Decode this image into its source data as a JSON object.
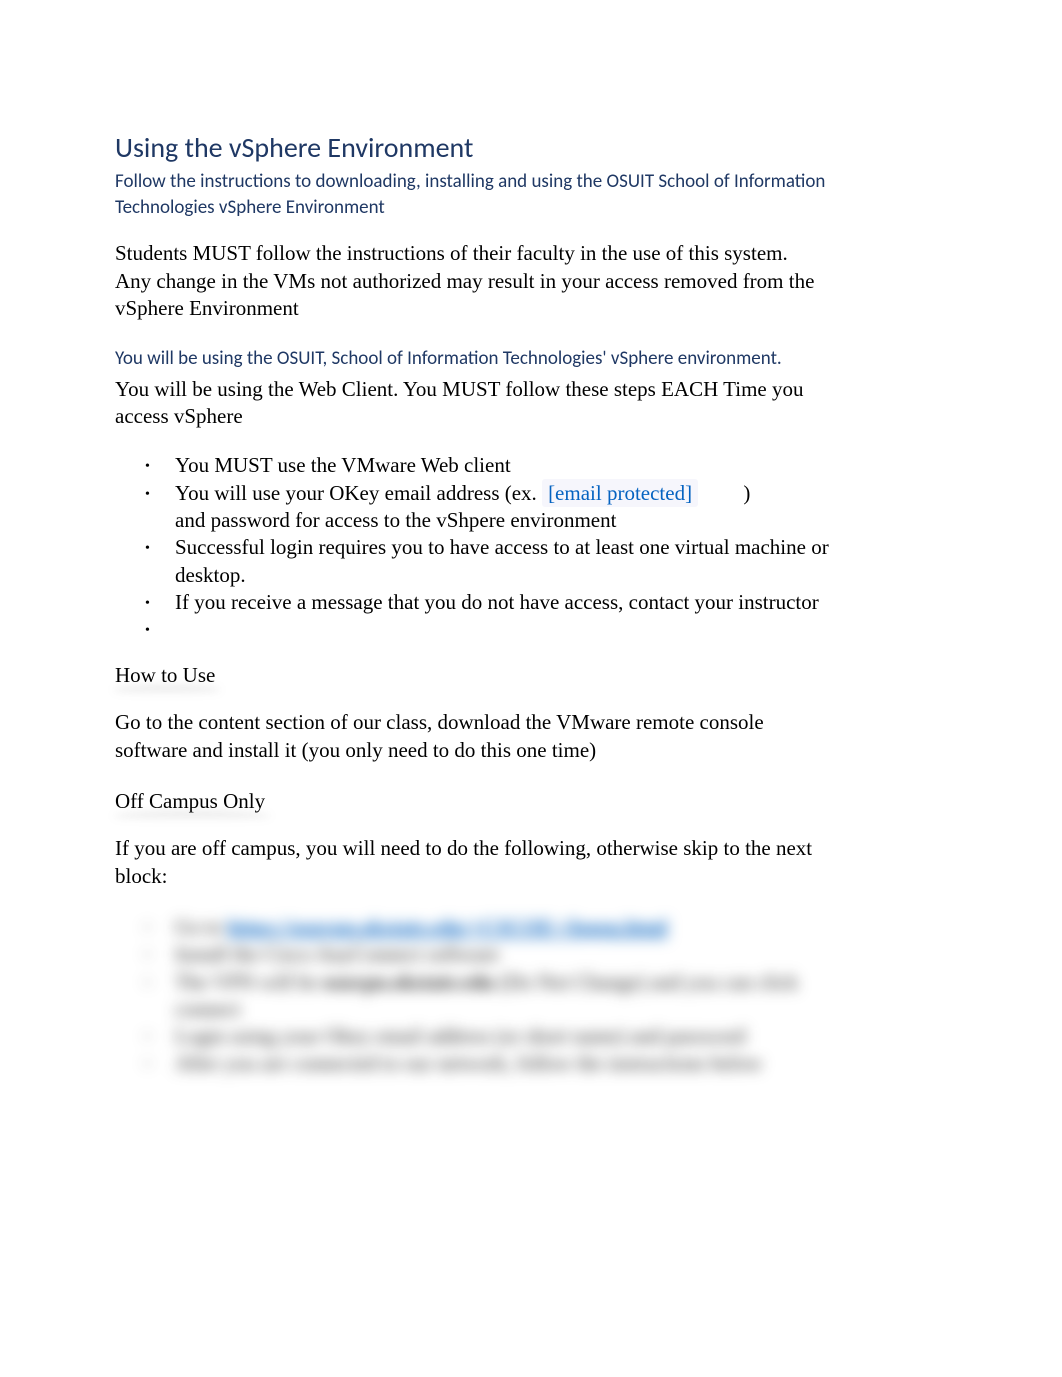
{
  "title": "Using the vSphere Environment",
  "subtitle": "Follow the instructions to downloading, installing and using the OSUIT School of Information Technologies vSphere Environment",
  "warning_paragraph": "Students MUST follow the instructions of their faculty in the use of this system. Any change in the VMs not authorized may result in your access removed from the vSphere Environment",
  "env_heading": "You will be using the OSUIT, School of Information Technologies' vSphere environment.",
  "web_client_note": "You will be using the Web Client. You MUST follow these steps EACH Time you access vSphere",
  "bullets": {
    "b1": "You MUST use the VMware Web client",
    "b2_part1": "You will use your OKey email address (ex. ",
    "b2_email": "[email protected]",
    "b2_part2": ")",
    "b2_line2": "and password for access to the vShpere environment",
    "b3": "Successful login requires you to have access to at least one virtual machine or desktop.",
    "b4": "If you receive a message that you do not have access, contact your instructor"
  },
  "how_to_use_heading": "How to Use",
  "how_to_use_text": "Go to the content section of our class, download the VMware remote console software and install it (you only need to do this one time)",
  "off_campus_heading": "Off Campus Only",
  "off_campus_text": "If you are off campus, you will need to do the following, otherwise skip to the next block:",
  "blurred": {
    "b1_prefix": "Go to ",
    "b1_link": "https://osuvpn.okstate.edu/+CSCOE+/logon.html",
    "b2": "Install the Cisco AnyConnect software",
    "b3_part1": "The VPN will be ",
    "b3_bold": "osuvpn.okstate.edu",
    "b3_part2": " (Do Not Change) and you can click connect",
    "b4": "Login using your Okey email address (or short name) and password",
    "b5": "After you are connected to our network, follow the instructions below"
  }
}
